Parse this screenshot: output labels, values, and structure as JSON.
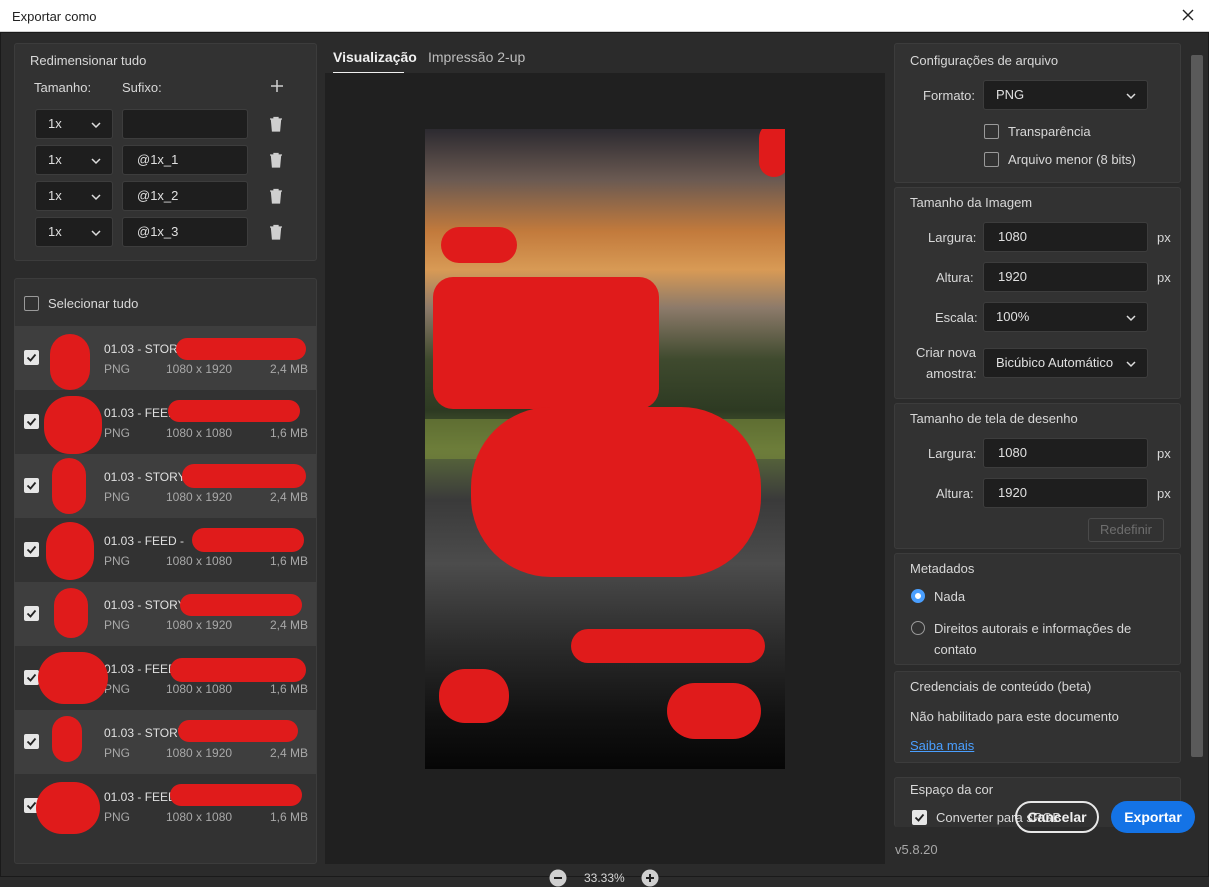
{
  "window": {
    "title": "Exportar como",
    "version": "v5.8.20"
  },
  "resize": {
    "title": "Redimensionar tudo",
    "size_label": "Tamanho:",
    "suffix_label": "Sufixo:",
    "rows": [
      {
        "scale": "1x",
        "suffix": ""
      },
      {
        "scale": "1x",
        "suffix": "@1x_1"
      },
      {
        "scale": "1x",
        "suffix": "@1x_2"
      },
      {
        "scale": "1x",
        "suffix": "@1x_3"
      }
    ]
  },
  "files": {
    "select_all": "Selecionar tudo",
    "items": [
      {
        "name": "01.03 - STORY",
        "format": "PNG",
        "dims": "1080 x 1920",
        "size": "2,4 MB"
      },
      {
        "name": "01.03 - FEED",
        "format": "PNG",
        "dims": "1080 x 1080",
        "size": "1,6 MB"
      },
      {
        "name": "01.03 - STORY",
        "format": "PNG",
        "dims": "1080 x 1920",
        "size": "2,4 MB"
      },
      {
        "name": "01.03 - FEED -",
        "format": "PNG",
        "dims": "1080 x 1080",
        "size": "1,6 MB"
      },
      {
        "name": "01.03 - STORY",
        "format": "PNG",
        "dims": "1080 x 1920",
        "size": "2,4 MB"
      },
      {
        "name": "01.03 - FEED",
        "format": "PNG",
        "dims": "1080 x 1080",
        "size": "1,6 MB"
      },
      {
        "name": "01.03 - STORY",
        "format": "PNG",
        "dims": "1080 x 1920",
        "size": "2,4 MB"
      },
      {
        "name": "01.03 - FEED",
        "format": "PNG",
        "dims": "1080 x 1080",
        "size": "1,6 MB"
      }
    ]
  },
  "preview": {
    "tab_active": "Visualização",
    "tab_other": "Impressão 2-up",
    "zoom": "33.33%"
  },
  "file_settings": {
    "title": "Configurações de arquivo",
    "format_label": "Formato:",
    "format_value": "PNG",
    "transparency": "Transparência",
    "smaller_file": "Arquivo menor (8 bits)"
  },
  "image_size": {
    "title": "Tamanho da Imagem",
    "width_label": "Largura:",
    "width_value": "1080",
    "height_label": "Altura:",
    "height_value": "1920",
    "scale_label": "Escala:",
    "scale_value": "100%",
    "resample_label_1": "Criar nova",
    "resample_label_2": "amostra:",
    "resample_value": "Bicúbico Automático",
    "unit": "px"
  },
  "canvas_size": {
    "title": "Tamanho de tela de desenho",
    "width_label": "Largura:",
    "width_value": "1080",
    "height_label": "Altura:",
    "height_value": "1920",
    "unit": "px",
    "reset": "Redefinir"
  },
  "metadata": {
    "title": "Metadados",
    "option_none": "Nada",
    "option_copyright_1": "Direitos autorais e informações de",
    "option_copyright_2": "contato"
  },
  "credentials": {
    "title": "Credenciais de conteúdo (beta)",
    "status": "Não habilitado para este documento",
    "link": "Saiba mais"
  },
  "color_space": {
    "title": "Espaço da cor",
    "convert": "Converter para sRGB"
  },
  "actions": {
    "cancel": "Cancelar",
    "export": "Exportar"
  },
  "colors": {
    "accent": "#1473e6",
    "redaction": "#e01b1b",
    "link": "#4a9fff"
  }
}
